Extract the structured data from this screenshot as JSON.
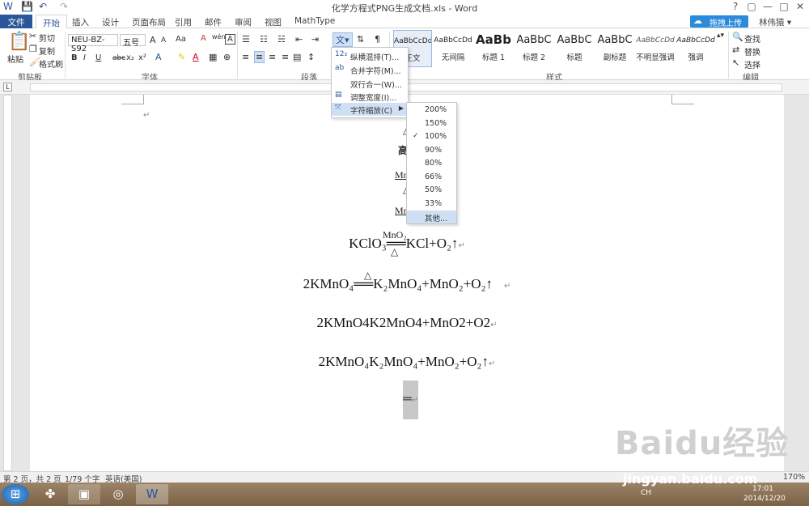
{
  "window": {
    "title": "化学方程式PNG生成文档.xls - Word",
    "help": "?",
    "restore": "▢",
    "minimize": "—",
    "maximize": "□",
    "close": "✕"
  },
  "qat": {
    "save": "💾",
    "undo": "↶",
    "redo": "↷"
  },
  "tabs": [
    "文件",
    "开始",
    "插入",
    "设计",
    "页面布局",
    "引用",
    "邮件",
    "审阅",
    "视图",
    "MathType"
  ],
  "upload_button": "拖拽上传",
  "user": "林伟猿 ▾",
  "ribbon": {
    "clipboard": {
      "paste": "粘贴",
      "cut": "剪切",
      "copy": "复制",
      "format_painter": "格式刷",
      "label": "剪贴板"
    },
    "font": {
      "name": "NEU-BZ-S92",
      "size": "五号",
      "grow": "A",
      "shrink": "A",
      "case": "Aa",
      "clear": "A",
      "phonetic": "wén",
      "border": "A",
      "bold": "B",
      "italic": "I",
      "underline": "U",
      "strike": "abc",
      "sub": "x₂",
      "sup": "x²",
      "label": "字体"
    },
    "paragraph": {
      "label": "段落"
    },
    "styles": {
      "items": [
        {
          "preview": "AaBbCcDd",
          "name": "正文"
        },
        {
          "preview": "AaBbCcDd",
          "name": "无间隔"
        },
        {
          "preview": "AaBb",
          "name": "标题 1"
        },
        {
          "preview": "AaBbC",
          "name": "标题 2"
        },
        {
          "preview": "AaBbC",
          "name": "标题"
        },
        {
          "preview": "AaBbC",
          "name": "副标题"
        },
        {
          "preview": "AaBbCcDd",
          "name": "不明显强调"
        },
        {
          "preview": "AaBbCcDd",
          "name": "强调"
        }
      ],
      "label": "样式"
    },
    "editing": {
      "find": "查找",
      "replace": "替换",
      "select": "选择",
      "label": "编辑"
    }
  },
  "menu": {
    "items": [
      "纵横混排(T)...",
      "合并字符(M)...",
      "双行合一(W)...",
      "调整宽度(I)...",
      "字符缩放(C)"
    ]
  },
  "scale_menu": {
    "items": [
      "200%",
      "150%",
      "100%",
      "90%",
      "80%",
      "66%",
      "50%",
      "33%",
      "其他..."
    ],
    "checked": "100%"
  },
  "doc": {
    "frag1": "高",
    "frag2": "Mr",
    "frag3": "△",
    "frag4": "Mr",
    "eq1": "KClO₃══KCl+O₂↑",
    "eq1_over": "MnO₂",
    "eq1_under": "△",
    "eq2": "2KMnO₄══K₂MnO₄+MnO₂+O₂↑",
    "eq2_over": "△",
    "eq3": "2KMnO4K2MnO4+MnO2+O2",
    "eq4": "2KMnO₄K₂MnO₄+MnO₂+O₂↑",
    "eq5": "═",
    "pilcrow": "↵"
  },
  "status": {
    "page": "第 2 页，共 2 页",
    "words": "1/79 个字",
    "lang": "英语(美国)",
    "zoom": "170%"
  },
  "taskbar": {
    "time": "17:01",
    "date": "2014/12/20",
    "ime": "CH"
  },
  "watermark": {
    "logo": "Baidu经验",
    "url": "jingyan.baidu.com"
  },
  "colors": {
    "accent": "#2b579a",
    "upload": "#2a8bdb"
  }
}
